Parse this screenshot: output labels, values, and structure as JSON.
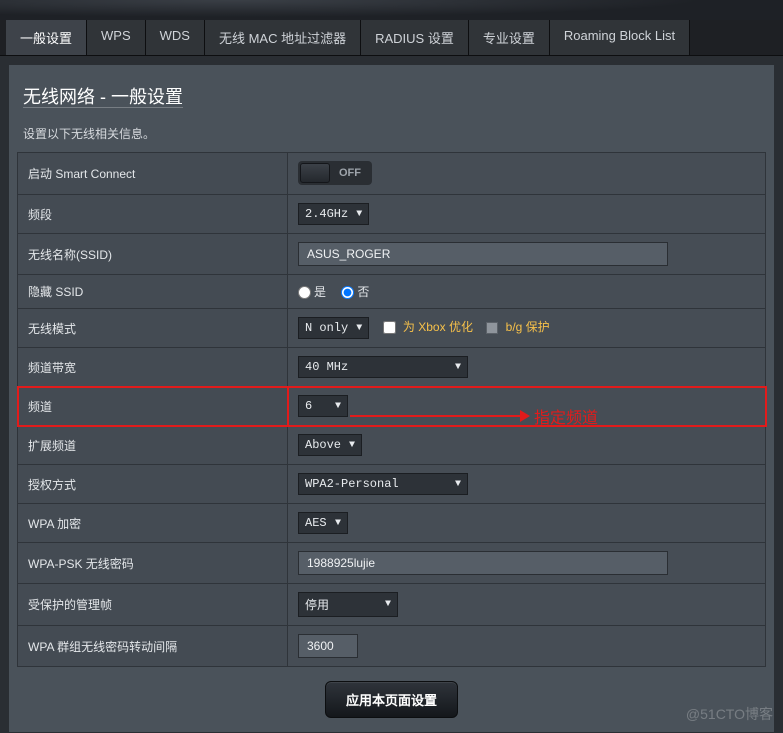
{
  "tabs": [
    {
      "label": "一般设置",
      "active": true
    },
    {
      "label": "WPS",
      "active": false
    },
    {
      "label": "WDS",
      "active": false
    },
    {
      "label": "无线 MAC 地址过滤器",
      "active": false
    },
    {
      "label": "RADIUS 设置",
      "active": false
    },
    {
      "label": "专业设置",
      "active": false
    },
    {
      "label": "Roaming Block List",
      "active": false
    }
  ],
  "panel": {
    "title": "无线网络 - 一般设置",
    "description": "设置以下无线相关信息。"
  },
  "fields": {
    "smart_connect": {
      "label": "启动 Smart Connect",
      "toggle_state": "OFF"
    },
    "band": {
      "label": "频段",
      "value": "2.4GHz"
    },
    "ssid": {
      "label": "无线名称(SSID)",
      "value": "ASUS_ROGER"
    },
    "hide_ssid": {
      "label": "隐藏 SSID",
      "yes": "是",
      "no": "否",
      "selected": "no"
    },
    "mode": {
      "label": "无线模式",
      "value": "N only",
      "opt_xbox": "为 Xbox 优化",
      "opt_bg": "b/g 保护"
    },
    "bandwidth": {
      "label": "频道带宽",
      "value": "40 MHz"
    },
    "channel": {
      "label": "频道",
      "value": "6"
    },
    "ext_channel": {
      "label": "扩展频道",
      "value": "Above"
    },
    "auth": {
      "label": "授权方式",
      "value": "WPA2-Personal"
    },
    "wpa_enc": {
      "label": "WPA 加密",
      "value": "AES"
    },
    "wpa_psk": {
      "label": "WPA-PSK 无线密码",
      "value": "1988925lujie"
    },
    "pmf": {
      "label": "受保护的管理帧",
      "value": "停用"
    },
    "gtk": {
      "label": "WPA 群组无线密码转动间隔",
      "value": "3600"
    }
  },
  "apply_button": "应用本页面设置",
  "annotation": "指定频道",
  "watermark": "@51CTO博客"
}
